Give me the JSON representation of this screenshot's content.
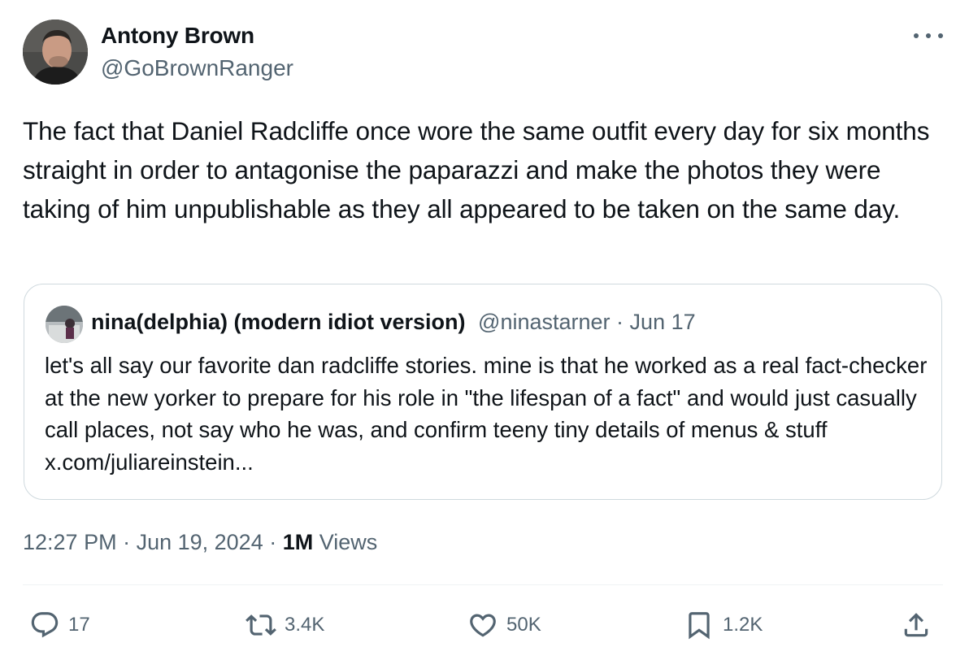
{
  "author": {
    "name": "Antony Brown",
    "handle": "@GoBrownRanger"
  },
  "tweet": {
    "text": "The fact that Daniel Radcliffe once wore the same outfit every day for six months straight in order to antagonise the paparazzi and make the photos they were taking of him unpublishable as they all appeared to be taken on the same day."
  },
  "quoted": {
    "name": "nina(delphia) (modern idiot version)",
    "handle": "@ninastarner",
    "separator": " · ",
    "date": "Jun 17",
    "text": "let's all say our favorite dan radcliffe stories. mine is that he worked as a real fact-checker at the new yorker to prepare for his role in \"the lifespan of a fact\" and would just casually call places, not say who he was, and confirm teeny tiny details of menus & stuff x.com/juliareinstein..."
  },
  "meta": {
    "time": "12:27 PM",
    "separator": " · ",
    "date": "Jun 19, 2024",
    "views_count": "1M",
    "views_label": " Views"
  },
  "actions": {
    "replies": "17",
    "reposts": "3.4K",
    "likes": "50K",
    "bookmarks": "1.2K"
  },
  "icons": {
    "more": "more-horizontal-icon",
    "reply": "reply-icon",
    "repost": "repost-icon",
    "like": "heart-icon",
    "bookmark": "bookmark-icon",
    "share": "share-icon"
  },
  "colors": {
    "text": "#0f1419",
    "secondary": "#536471",
    "border": "#cfd9de"
  }
}
